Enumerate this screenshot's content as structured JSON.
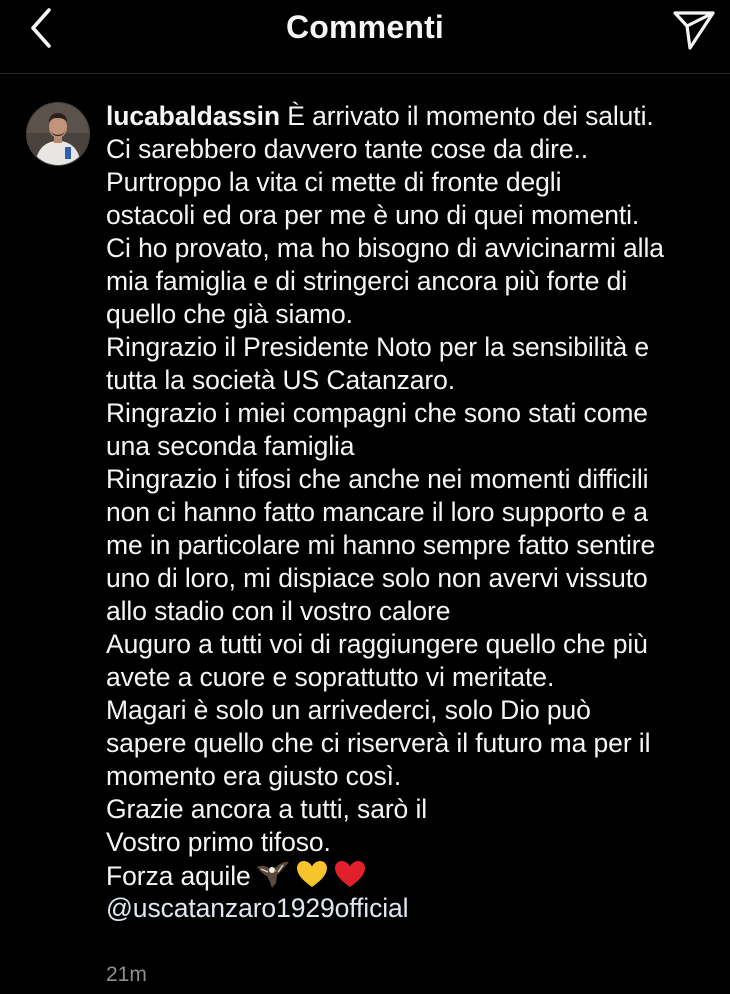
{
  "header": {
    "title": "Commenti",
    "back_icon": "chevron-left-icon",
    "send_icon": "paper-plane-icon"
  },
  "comment": {
    "username": "lucabaldassin",
    "lines": [
      "È arrivato il momento dei saluti.",
      "Ci sarebbero davvero tante cose da dire..",
      "Purtroppo la vita ci mette di fronte degli",
      "ostacoli ed ora per me è uno di quei momenti.",
      "Ci ho provato, ma ho bisogno di avvicinarmi alla",
      "mia famiglia e di stringerci ancora più forte di",
      "quello che già siamo.",
      "Ringrazio il Presidente Noto per la sensibilità e",
      "tutta la società US Catanzaro.",
      "Ringrazio i miei compagni che sono stati come",
      "una seconda famiglia",
      "Ringrazio i tifosi che anche nei momenti difficili",
      "non ci hanno fatto mancare il loro supporto e a",
      "me in particolare mi hanno sempre fatto sentire",
      "uno di loro, mi dispiace solo non avervi vissuto",
      "allo stadio con il vostro calore",
      "Auguro a tutti voi di raggiungere quello che più",
      "avete a cuore e soprattutto vi meritate.",
      "Magari è solo un arrivederci, solo Dio può",
      "sapere quello che ci riserverà il futuro ma per il",
      "momento era giusto così.",
      "Grazie ancora a tutti, sarò il",
      "Vostro primo tifoso.",
      "Forza aquile"
    ],
    "emojis": [
      "eagle-icon",
      "yellow-heart-icon",
      "red-heart-icon"
    ],
    "mention": "@uscatanzaro1929official",
    "timestamp": "21m"
  },
  "colors": {
    "background": "#000000",
    "text": "#f5f5f5",
    "secondary": "#8e8e8e",
    "divider": "#262626",
    "yellow_heart": "#f7c52b",
    "red_heart": "#e0202b"
  }
}
